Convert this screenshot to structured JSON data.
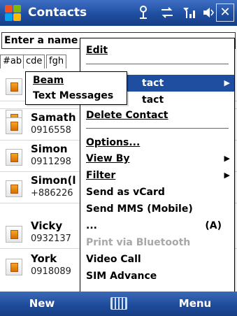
{
  "titlebar": {
    "title": "Contacts",
    "icons": [
      "antenna-icon",
      "sync-icon",
      "signal-icon",
      "speaker-icon"
    ],
    "close_label": "✕"
  },
  "search": {
    "value": "Enter a name"
  },
  "alpha_tabs": [
    "#ab",
    "cde",
    "fgh"
  ],
  "contacts": [
    {
      "name": "",
      "number": ""
    },
    {
      "name": "",
      "number": ""
    },
    {
      "name": "Samath",
      "number": "0916558"
    },
    {
      "name": "Simon",
      "number": "0911298"
    },
    {
      "name": "Simon(l",
      "number": "+886226"
    },
    {
      "name": "Vicky",
      "number": "0932137"
    },
    {
      "name": "York",
      "number": "0918089"
    }
  ],
  "menu": {
    "items": [
      {
        "label": "Edit",
        "accel": "E",
        "state": "normal"
      },
      {
        "label": "tact",
        "state": "selected",
        "submenu": true
      },
      {
        "label": "tact",
        "state": "normal"
      },
      {
        "label": "Delete Contact",
        "accel": "D",
        "state": "normal"
      },
      {
        "label": "Options...",
        "accel": "O",
        "state": "normal"
      },
      {
        "label": "View By",
        "accel": "V",
        "state": "normal",
        "submenu": true
      },
      {
        "label": "Filter",
        "accel": "F",
        "state": "normal",
        "submenu": true
      },
      {
        "label": "Send as vCard",
        "accel": "n",
        "state": "normal"
      },
      {
        "label": "Send MMS (Mobile)",
        "accel": "M",
        "state": "normal"
      },
      {
        "label": "...",
        "state": "normal",
        "shortcut": "(A)"
      },
      {
        "label": "Print via Bluetooth",
        "state": "disabled"
      },
      {
        "label": "Video Call",
        "accel": "i",
        "state": "normal"
      },
      {
        "label": "SIM Advance",
        "accel": "S",
        "state": "normal"
      }
    ]
  },
  "submenu": {
    "items": [
      {
        "label": "Beam",
        "accel": "B"
      },
      {
        "label": "Text Messages",
        "accel": "T"
      }
    ]
  },
  "bottombar": {
    "left": "New",
    "right": "Menu"
  },
  "colors": {
    "titlebar": "#1f4ea0",
    "selection": "#1f4ea0",
    "separator": "#3c6cc0"
  }
}
